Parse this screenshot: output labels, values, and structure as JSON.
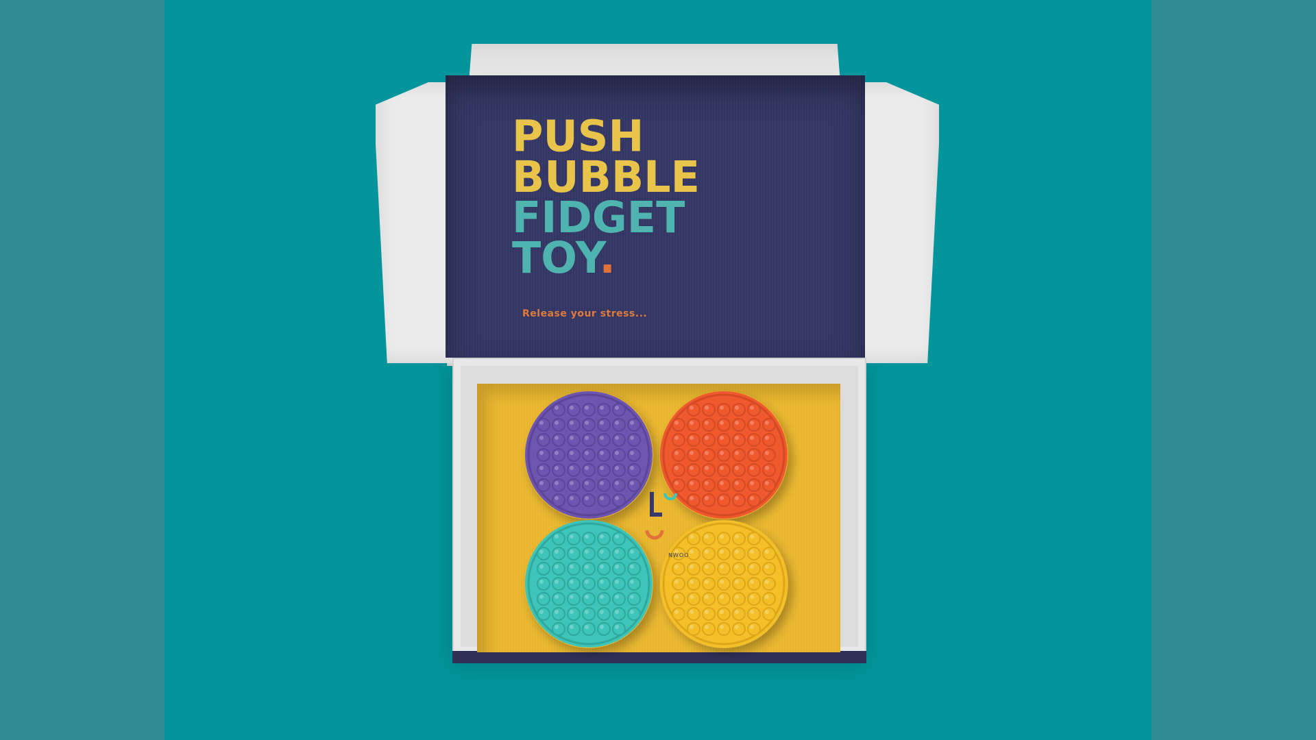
{
  "colors": {
    "background": "#02959b",
    "lid": "#343765",
    "headline_yellow": "#e9c44a",
    "headline_teal": "#4fb3af",
    "accent_orange": "#e2703a",
    "tray": "#ecb92f"
  },
  "lid": {
    "headline": {
      "line1": "PUSH",
      "line2": "BUBBLE",
      "line3": "FIDGET",
      "line4": "TOY",
      "period": "."
    },
    "tagline": "Release your stress..."
  },
  "tray": {
    "toys": [
      {
        "name": "purple-fidget-toy",
        "color": "#6e56b0",
        "shade": "#5b4599"
      },
      {
        "name": "orange-fidget-toy",
        "color": "#f0582e",
        "shade": "#d44a24"
      },
      {
        "name": "teal-fidget-toy",
        "color": "#3ec4b8",
        "shade": "#2fa89e"
      },
      {
        "name": "yellow-fidget-toy",
        "color": "#f3c02a",
        "shade": "#dca819"
      }
    ],
    "logo_text": "NWOO"
  }
}
